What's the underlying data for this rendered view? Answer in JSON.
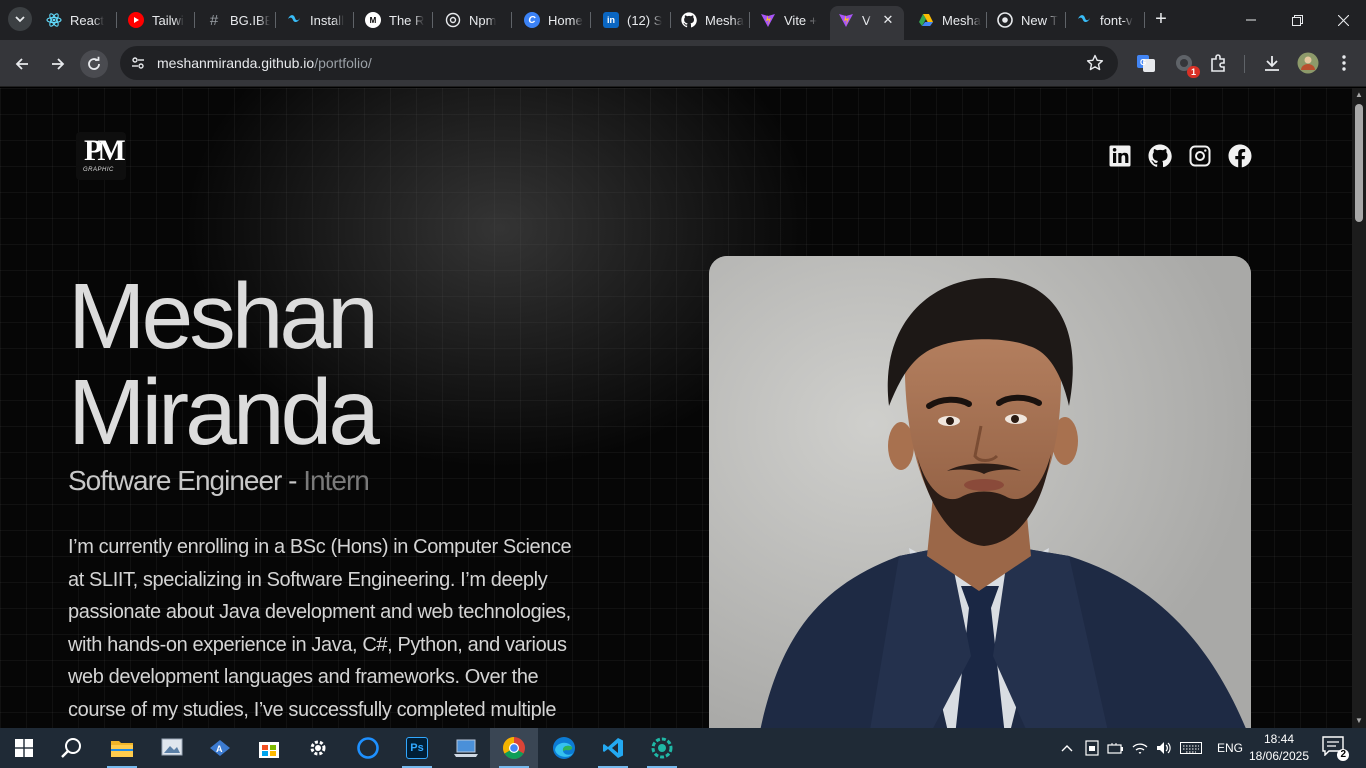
{
  "browser": {
    "tabs": [
      {
        "label": "React",
        "icon": "react-icon",
        "color": "#61dafb"
      },
      {
        "label": "Tailwi",
        "icon": "youtube-icon",
        "color": "#ff0000"
      },
      {
        "label": "BG.IBE",
        "icon": "hash-icon",
        "color": "#9aa0a6"
      },
      {
        "label": "Install",
        "icon": "tailwind-icon",
        "color": "#38bdf8"
      },
      {
        "label": "The R",
        "icon": "medium-icon",
        "color": "#ffffff"
      },
      {
        "label": "Npm",
        "icon": "npm-globe-icon",
        "color": "#e8eaed"
      },
      {
        "label": "Home",
        "icon": "canva-icon",
        "color": "#3b82f6"
      },
      {
        "label": "(12) S",
        "icon": "linkedin-icon",
        "color": "#0a66c2"
      },
      {
        "label": "Mesha",
        "icon": "github-icon",
        "color": "#ffffff"
      },
      {
        "label": "Vite +",
        "icon": "vite-icon",
        "color": "#a855f7"
      },
      {
        "label": "V",
        "icon": "vite-icon",
        "color": "#a855f7",
        "active": true
      },
      {
        "label": "Mesha",
        "icon": "google-drive-icon",
        "color": "#34a853"
      },
      {
        "label": "New T",
        "icon": "chrome-icon",
        "color": "#e8eaed"
      },
      {
        "label": "font-v",
        "icon": "tailwind-icon",
        "color": "#38bdf8"
      }
    ],
    "tab_close_glyph": "✕",
    "new_tab_glyph": "+",
    "url_host": "meshanmiranda.github.io",
    "url_path": "/portfolio/",
    "extension_badge": "1"
  },
  "page": {
    "logo_mark": "PM",
    "logo_sub": "GRAPHIC",
    "social_links": [
      {
        "name": "linkedin-link",
        "icon": "linkedin-icon"
      },
      {
        "name": "github-link",
        "icon": "github-icon"
      },
      {
        "name": "instagram-link",
        "icon": "instagram-icon"
      },
      {
        "name": "facebook-link",
        "icon": "facebook-icon"
      }
    ],
    "name_first": "Meshan",
    "name_last": "Miranda",
    "role_main": "Software Engineer - ",
    "role_intern": "Intern",
    "bio": "I’m currently enrolling in a BSc (Hons) in Computer Science at SLIIT, specializing in Software Engineering. I’m deeply passionate about Java development and web technologies, with hands-on experience in Java, C#, Python, and various web development languages and frameworks. Over the course of my studies, I’ve successfully completed multiple",
    "colors": {
      "background": "#060606",
      "text": "#dcdcdc",
      "muted": "#7a7a7a"
    }
  },
  "taskbar": {
    "apps": [
      "start-icon",
      "search-icon",
      "file-explorer-icon",
      "photos-icon",
      "app-icon",
      "microsoft-store-icon",
      "settings-icon",
      "cortana-icon",
      "photoshop-icon",
      "laptop-icon",
      "chrome-icon",
      "edge-icon",
      "vscode-icon",
      "app-icon"
    ],
    "language": "ENG",
    "time": "18:44",
    "date": "18/06/2025",
    "notification_count": "2",
    "photoshop_label": "Ps"
  }
}
